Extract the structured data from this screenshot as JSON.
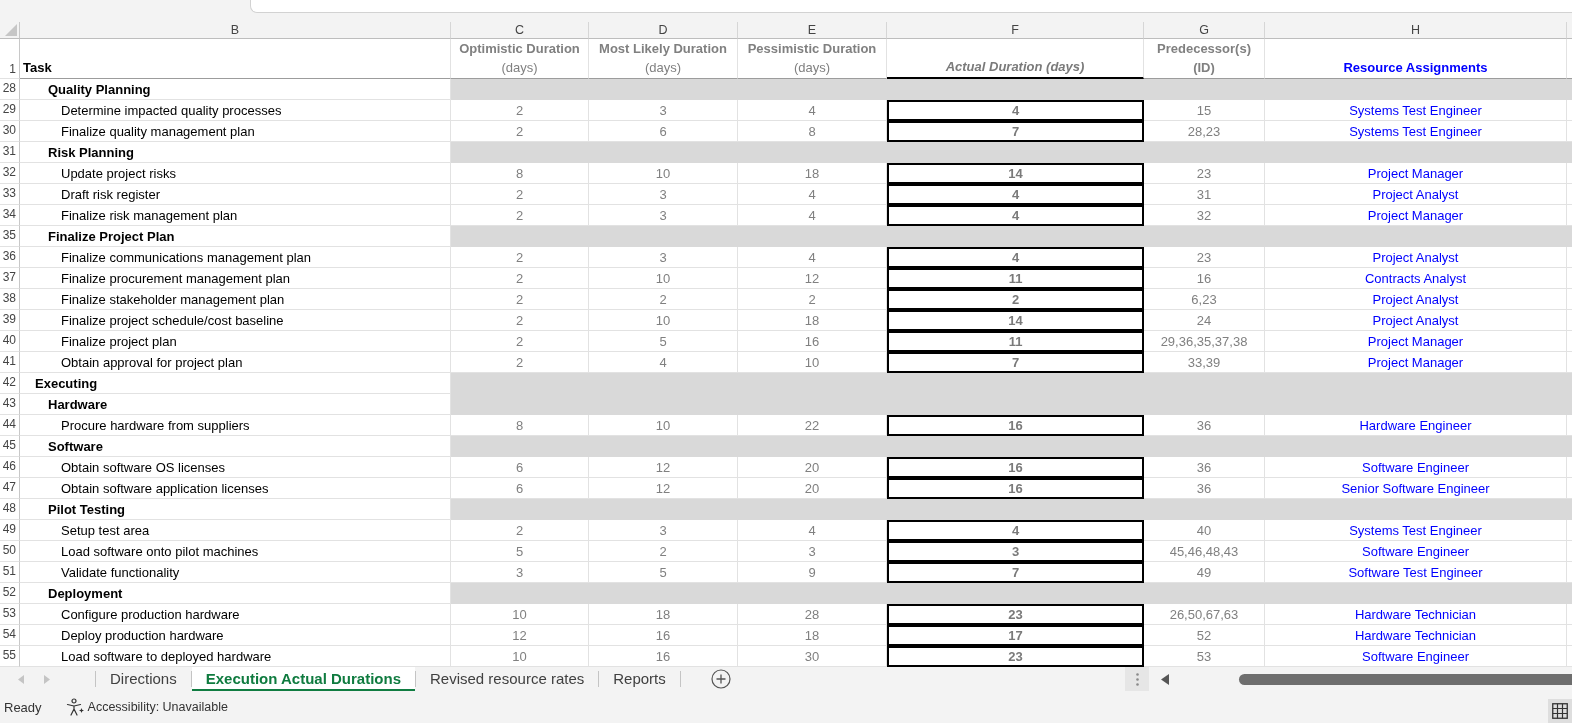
{
  "column_letters": [
    "B",
    "C",
    "D",
    "E",
    "F",
    "G",
    "H"
  ],
  "header_row": {
    "number": "1",
    "task": "Task",
    "optimistic": [
      "Optimistic Duration",
      "(days)"
    ],
    "most_likely": [
      "Most Likely Duration",
      "(days)"
    ],
    "pessimistic": [
      "Pessimistic Duration",
      "(days)"
    ],
    "actual": "Actual Duration (days)",
    "predecessors": [
      "Predecessor(s)",
      "(ID)"
    ],
    "resource": "Resource Assignments"
  },
  "outline": [
    {
      "kind": "heading",
      "children": [
        {
          "kind": "heading",
          "row": "28",
          "task": "Quality Planning",
          "children": [
            {
              "kind": "task",
              "row": "29",
              "task": "Determine impacted quality processes",
              "optimistic": "2",
              "most_likely": "3",
              "pessimistic": "4",
              "actual": "4",
              "predecessors": "15",
              "resource": "Systems Test Engineer"
            },
            {
              "kind": "task",
              "row": "30",
              "task": "Finalize quality management plan",
              "optimistic": "2",
              "most_likely": "6",
              "pessimistic": "8",
              "actual": "7",
              "predecessors": "28,23",
              "resource": "Systems Test Engineer"
            }
          ]
        },
        {
          "kind": "heading",
          "row": "31",
          "task": "Risk Planning",
          "children": [
            {
              "kind": "task",
              "row": "32",
              "task": "Update project risks",
              "optimistic": "8",
              "most_likely": "10",
              "pessimistic": "18",
              "actual": "14",
              "predecessors": "23",
              "resource": "Project Manager"
            },
            {
              "kind": "task",
              "row": "33",
              "task": "Draft risk register",
              "optimistic": "2",
              "most_likely": "3",
              "pessimistic": "4",
              "actual": "4",
              "predecessors": "31",
              "resource": "Project Analyst"
            },
            {
              "kind": "task",
              "row": "34",
              "task": "Finalize risk management plan",
              "optimistic": "2",
              "most_likely": "3",
              "pessimistic": "4",
              "actual": "4",
              "predecessors": "32",
              "resource": "Project Manager"
            }
          ]
        },
        {
          "kind": "heading",
          "row": "35",
          "task": "Finalize Project Plan",
          "children": [
            {
              "kind": "task",
              "row": "36",
              "task": "Finalize communications management plan",
              "optimistic": "2",
              "most_likely": "3",
              "pessimistic": "4",
              "actual": "4",
              "predecessors": "23",
              "resource": "Project Analyst"
            },
            {
              "kind": "task",
              "row": "37",
              "task": "Finalize procurement management plan",
              "optimistic": "2",
              "most_likely": "10",
              "pessimistic": "12",
              "actual": "11",
              "predecessors": "16",
              "resource": "Contracts Analyst"
            },
            {
              "kind": "task",
              "row": "38",
              "task": "Finalize stakeholder management plan",
              "optimistic": "2",
              "most_likely": "2",
              "pessimistic": "2",
              "actual": "2",
              "predecessors": "6,23",
              "resource": "Project Analyst"
            },
            {
              "kind": "task",
              "row": "39",
              "task": "Finalize project schedule/cost baseline",
              "optimistic": "2",
              "most_likely": "10",
              "pessimistic": "18",
              "actual": "14",
              "predecessors": "24",
              "resource": "Project Analyst"
            },
            {
              "kind": "task",
              "row": "40",
              "task": "Finalize project plan",
              "optimistic": "2",
              "most_likely": "5",
              "pessimistic": "16",
              "actual": "11",
              "predecessors": "29,36,35,37,38",
              "resource": "Project Manager"
            },
            {
              "kind": "task",
              "row": "41",
              "task": "Obtain approval for project plan",
              "optimistic": "2",
              "most_likely": "4",
              "pessimistic": "10",
              "actual": "7",
              "predecessors": "33,39",
              "resource": "Project Manager"
            }
          ]
        }
      ]
    },
    {
      "kind": "heading",
      "row": "42",
      "task": "Executing",
      "children": [
        {
          "kind": "heading",
          "row": "43",
          "task": "Hardware",
          "children": [
            {
              "kind": "task",
              "row": "44",
              "task": "Procure hardware from suppliers",
              "optimistic": "8",
              "most_likely": "10",
              "pessimistic": "22",
              "actual": "16",
              "predecessors": "36",
              "resource": "Hardware Engineer"
            }
          ]
        },
        {
          "kind": "heading",
          "row": "45",
          "task": "Software",
          "children": [
            {
              "kind": "task",
              "row": "46",
              "task": "Obtain software OS licenses",
              "optimistic": "6",
              "most_likely": "12",
              "pessimistic": "20",
              "actual": "16",
              "predecessors": "36",
              "resource": "Software Engineer"
            },
            {
              "kind": "task",
              "row": "47",
              "task": "Obtain software application licenses",
              "optimistic": "6",
              "most_likely": "12",
              "pessimistic": "20",
              "actual": "16",
              "predecessors": "36",
              "resource": "Senior Software Engineer"
            }
          ]
        },
        {
          "kind": "heading",
          "row": "48",
          "task": "Pilot Testing",
          "children": [
            {
              "kind": "task",
              "row": "49",
              "task": "Setup test area",
              "optimistic": "2",
              "most_likely": "3",
              "pessimistic": "4",
              "actual": "4",
              "predecessors": "40",
              "resource": "Systems Test Engineer"
            },
            {
              "kind": "task",
              "row": "50",
              "task": "Load software onto pilot machines",
              "optimistic": "5",
              "most_likely": "2",
              "pessimistic": "3",
              "actual": "3",
              "predecessors": "45,46,48,43",
              "resource": "Software Engineer"
            },
            {
              "kind": "task",
              "row": "51",
              "task": "Validate functionality",
              "optimistic": "3",
              "most_likely": "5",
              "pessimistic": "9",
              "actual": "7",
              "predecessors": "49",
              "resource": "Software Test Engineer"
            }
          ]
        },
        {
          "kind": "heading",
          "row": "52",
          "task": "Deployment",
          "children": [
            {
              "kind": "task",
              "row": "53",
              "task": "Configure production hardware",
              "optimistic": "10",
              "most_likely": "18",
              "pessimistic": "28",
              "actual": "23",
              "predecessors": "26,50,67,63",
              "resource": "Hardware Technician"
            },
            {
              "kind": "task",
              "row": "54",
              "task": "Deploy production hardware",
              "optimistic": "12",
              "most_likely": "16",
              "pessimistic": "18",
              "actual": "17",
              "predecessors": "52",
              "resource": "Hardware Technician"
            },
            {
              "kind": "task",
              "row": "55",
              "task": "Load software to deployed hardware",
              "optimistic": "10",
              "most_likely": "16",
              "pessimistic": "30",
              "actual": "23",
              "predecessors": "53",
              "resource": "Software Engineer"
            }
          ]
        }
      ]
    }
  ],
  "sheet_tabs": [
    {
      "label": "Directions",
      "selected": false
    },
    {
      "label": "Execution Actual Durations",
      "selected": true
    },
    {
      "label": "Revised resource rates",
      "selected": false
    },
    {
      "label": "Reports",
      "selected": false
    }
  ],
  "status_bar": {
    "mode": "Ready",
    "accessibility": "Accessibility: Unavailable"
  }
}
